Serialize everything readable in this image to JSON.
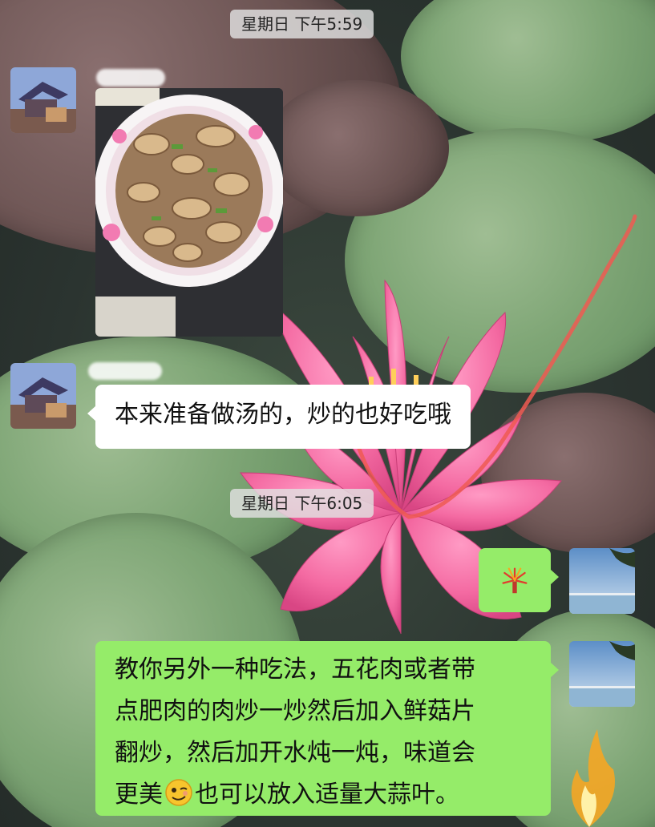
{
  "chat": {
    "timestamps": [
      "星期日 下午5:59",
      "星期日 下午6:05"
    ],
    "messages": [
      {
        "sender": "contact",
        "type": "image"
      },
      {
        "sender": "contact",
        "type": "text",
        "text": "本来准备做汤的，炒的也好吃哦"
      },
      {
        "sender": "me",
        "type": "emoji",
        "emoji_name": "fireworks-emoji"
      },
      {
        "sender": "me",
        "type": "text",
        "line1": "教你另外一种吃法，五花肉或者带",
        "line2": "点肥肉的肉炒一炒然后加入鲜菇片",
        "line3": "翻炒，然后加开水炖一炖，味道会",
        "line4_before": "更美",
        "line4_emoji": "wink-face-emoji",
        "line4_after": "也可以放入适量大蒜叶。"
      }
    ]
  },
  "colors": {
    "my_bubble": "#95ec69",
    "their_bubble": "#ffffff",
    "time_pill": "#e1e1e1",
    "annotation_stroke": "#ef5a52"
  }
}
